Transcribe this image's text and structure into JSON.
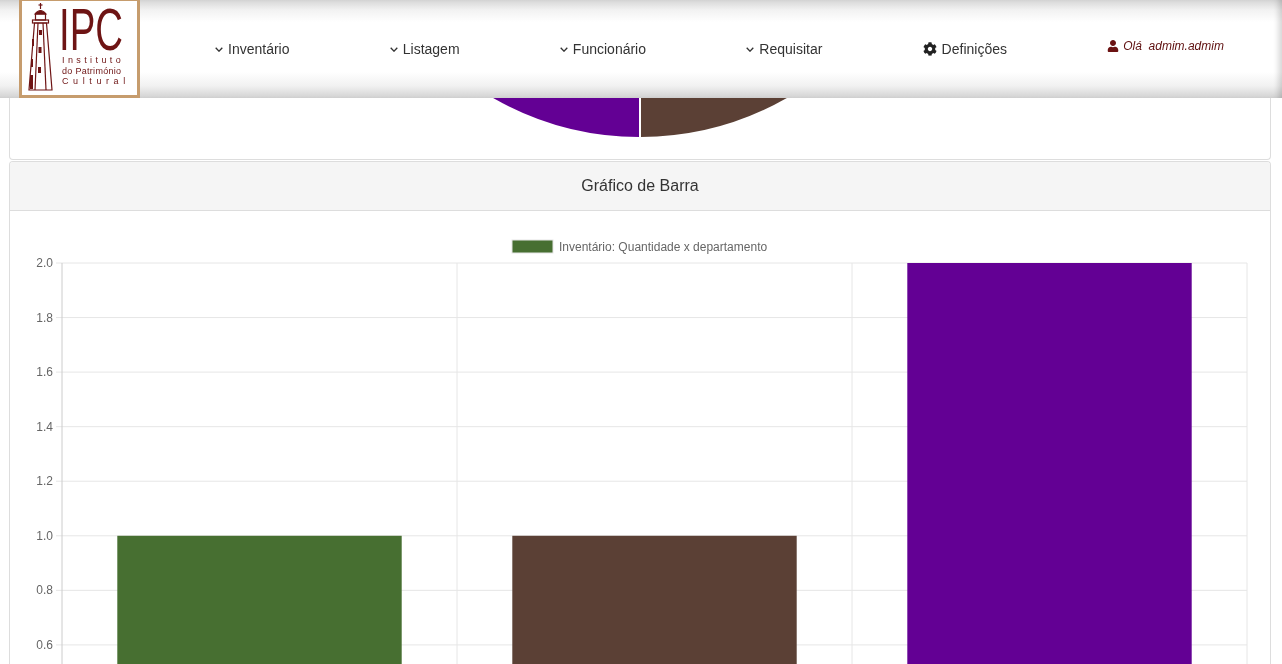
{
  "navbar": {
    "logo": {
      "initials": "IPC",
      "lines": [
        "Instituto",
        "do Património",
        "Cultural"
      ]
    },
    "menu": [
      {
        "label": "Inventário",
        "kind": "dropdown"
      },
      {
        "label": "Listagem",
        "kind": "dropdown"
      },
      {
        "label": "Funcionário",
        "kind": "dropdown"
      },
      {
        "label": "Requisitar",
        "kind": "dropdown"
      },
      {
        "label": "Definições",
        "kind": "settings"
      }
    ],
    "user": {
      "label": "Olá  admim.admim"
    }
  },
  "pie_chart": {
    "slices": [
      {
        "color": "#630094"
      },
      {
        "color": "#5b4035"
      }
    ]
  },
  "bar_chart": {
    "title": "Gráfico de Barra",
    "chart_data": {
      "type": "bar",
      "grid": true,
      "series": [
        {
          "name": "Inventário: Quantidade x departamento",
          "color": "#476f31",
          "colors": [
            "#476f31",
            "#5b4035",
            "#630094"
          ],
          "values": [
            1,
            1,
            2
          ]
        }
      ],
      "ylim": [
        0.53,
        2
      ],
      "yticks": [
        {
          "value": 0.6,
          "label": "0.6"
        },
        {
          "value": 0.8,
          "label": "0.8"
        },
        {
          "value": 1,
          "label": "1.0"
        },
        {
          "value": 1.2,
          "label": "1.2"
        },
        {
          "value": 1.4,
          "label": "1.4"
        },
        {
          "value": 1.6,
          "label": "1.6"
        },
        {
          "value": 1.8,
          "label": "1.8"
        },
        {
          "value": 2,
          "label": "2.0"
        }
      ]
    }
  }
}
